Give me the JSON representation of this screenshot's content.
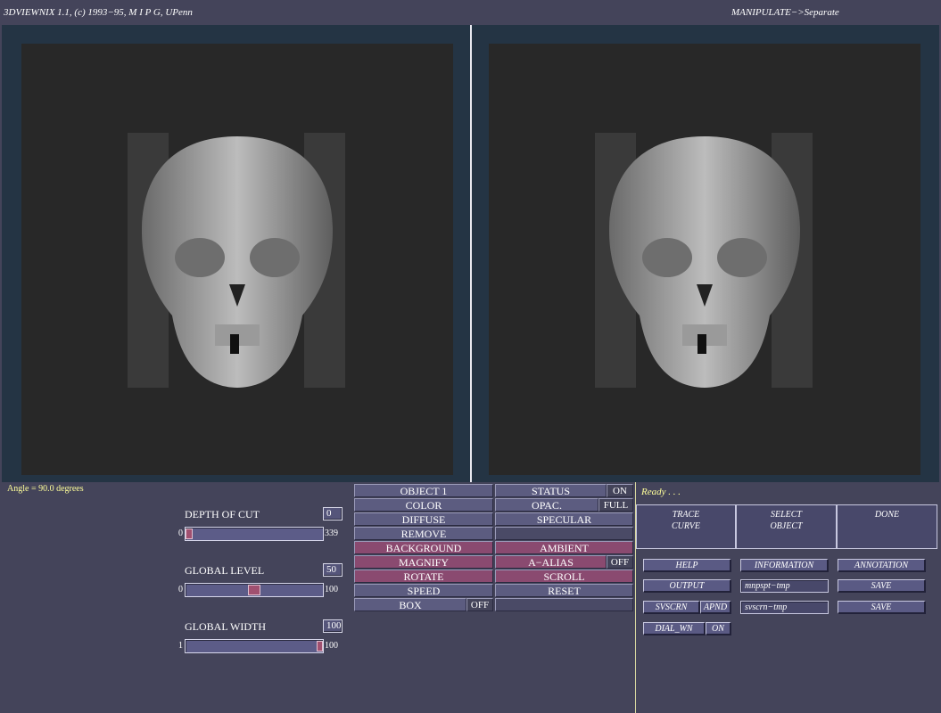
{
  "header": {
    "app_title": "3DVIEWNIX 1.1, (c) 1993−95, M I P G, UPenn",
    "mode_path": "MANIPULATE−>Separate"
  },
  "colors": {
    "background": "#44445a",
    "viewport_frame": "#243444",
    "canvas": "#282828",
    "button": "#5c5c80",
    "button_highlight": "#8a4a70",
    "status_text": "#ffff9a"
  },
  "panel": {
    "angle_text": "Angle = 90.0 degrees",
    "depth_of_cut": {
      "label": "DEPTH OF CUT",
      "value": "0",
      "min": "0",
      "max": "339",
      "fraction": 0.0
    },
    "global_level": {
      "label": "GLOBAL LEVEL",
      "value": "50",
      "min": "0",
      "max": "100",
      "fraction": 0.5
    },
    "global_width": {
      "label": "GLOBAL WIDTH",
      "value": "100",
      "min": "1",
      "max": "100",
      "fraction": 1.0
    }
  },
  "menu": {
    "object": "OBJECT 1",
    "status": "STATUS",
    "status_value": "ON",
    "color": "COLOR",
    "opac": "OPAC.",
    "opac_value": "FULL",
    "diffuse": "DIFFUSE",
    "specular": "SPECULAR",
    "remove": "REMOVE",
    "background": "BACKGROUND",
    "ambient": "AMBIENT",
    "magnify": "MAGNIFY",
    "a_alias": "A−ALIAS",
    "a_alias_value": "OFF",
    "rotate": "ROTATE",
    "scroll": "SCROLL",
    "speed": "SPEED",
    "reset": "RESET",
    "box": "BOX",
    "box_value": "OFF"
  },
  "right_panel": {
    "status": "Ready . . .",
    "trace_curve": [
      "TRACE",
      "CURVE"
    ],
    "select_object": [
      "SELECT",
      "OBJECT"
    ],
    "done": "DONE",
    "help": "HELP",
    "information": "INFORMATION",
    "annotation": "ANNOTATION",
    "output": "OUTPUT",
    "output_file": "mnpspt−tmp",
    "save1": "SAVE",
    "svscrn": "SVSCRN",
    "apnd": "APND",
    "svscrn_file": "svscrn−tmp",
    "save2": "SAVE",
    "dial_wn": "DIAL_WN",
    "dial_wn_value": "ON"
  },
  "icons": {
    "left_view": "skull-render-icon",
    "right_view": "skull-render-icon"
  }
}
